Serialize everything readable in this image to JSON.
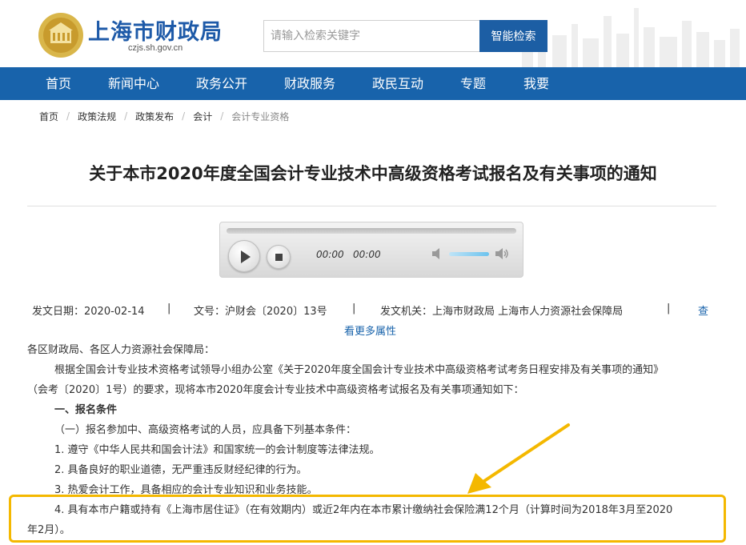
{
  "header": {
    "site_title": "上海市财政局",
    "site_domain": "czjs.sh.gov.cn",
    "search_placeholder": "请输入检索关键字",
    "search_button": "智能检索",
    "logo_icon": "city-emblem-icon",
    "accent": "#1863ab"
  },
  "nav": {
    "items": [
      "首页",
      "新闻中心",
      "政务公开",
      "财政服务",
      "政民互动",
      "专题",
      "我要"
    ]
  },
  "breadcrumb": [
    "首页",
    "政策法规",
    "政策发布",
    "会计",
    "会计专业资格"
  ],
  "article": {
    "title": "关于本市2020年度全国会计专业技术中高级资格考试报名及有关事项的通知",
    "player": {
      "current_time": "00:00",
      "duration": "00:00",
      "volume": 0.9
    },
    "meta": {
      "date": "发文日期：2020-02-14",
      "doc_no": "文号：沪财会〔2020〕13号",
      "issuer": "发文机关：上海市财政局 上海市人力资源社会保障局",
      "more_a": "查",
      "more_b": "看更多属性"
    },
    "body": {
      "salutation": "各区财政局、各区人力资源社会保障局：",
      "intro_1": "根据全国会计专业技术资格考试领导小组办公室《关于2020年度全国会计专业技术中高级资格考试考务日程安排及有关事项的通知》",
      "intro_2": "（会考〔2020〕1号）的要求，现将本市2020年度会计专业技术中高级资格考试报名及有关事项通知如下：",
      "section_1": "一、报名条件",
      "sub_1": "（一）报名参加中、高级资格考试的人员，应具备下列基本条件：",
      "item_1": "1. 遵守《中华人民共和国会计法》和国家统一的会计制度等法律法规。",
      "item_2": "2. 具备良好的职业道德，无严重违反财经纪律的行为。",
      "item_3": "3. 热爱会计工作，具备相应的会计专业知识和业务技能。",
      "item_4a": "4. 具有本市户籍或持有《上海市居住证》（在有效期内）或近2年内在本市累计缴纳社会保险满12个月（计算时间为2018年3月至2020",
      "item_4b": "年2月）。"
    }
  },
  "annotation": {
    "highlight_color": "#f4b800"
  }
}
